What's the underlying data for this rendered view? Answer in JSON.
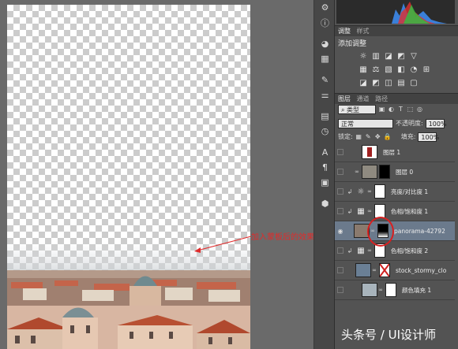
{
  "annotation": {
    "text": "加入蒙板后的效果"
  },
  "panels": {
    "adjust_tabs": [
      "调整",
      "样式"
    ],
    "adjust_title": "添加调整",
    "layers_tabs": [
      "图层",
      "通道",
      "路径"
    ],
    "filter_kind": "类型",
    "blend_mode": "正常",
    "opacity_label": "不透明度:",
    "opacity_value": "100%",
    "lock_label": "锁定:",
    "fill_label": "填充:",
    "fill_value": "100%"
  },
  "layers": [
    {
      "name": "图层 1",
      "kind": "image",
      "selected": false
    },
    {
      "name": "图层 0",
      "kind": "image-mask",
      "selected": false
    },
    {
      "name": "亮度/对比度 1",
      "kind": "adjustment",
      "selected": false
    },
    {
      "name": "色相/饱和度 1",
      "kind": "adjustment",
      "selected": false
    },
    {
      "name": "panorama-42792...",
      "kind": "image-mask",
      "selected": true
    },
    {
      "name": "色相/饱和度 2",
      "kind": "adjustment",
      "selected": false
    },
    {
      "name": "stock_stormy_clo...",
      "kind": "image-mask",
      "selected": false
    },
    {
      "name": "颜色填充 1",
      "kind": "fill",
      "selected": false
    }
  ],
  "watermark": "头条号 / UI设计师"
}
